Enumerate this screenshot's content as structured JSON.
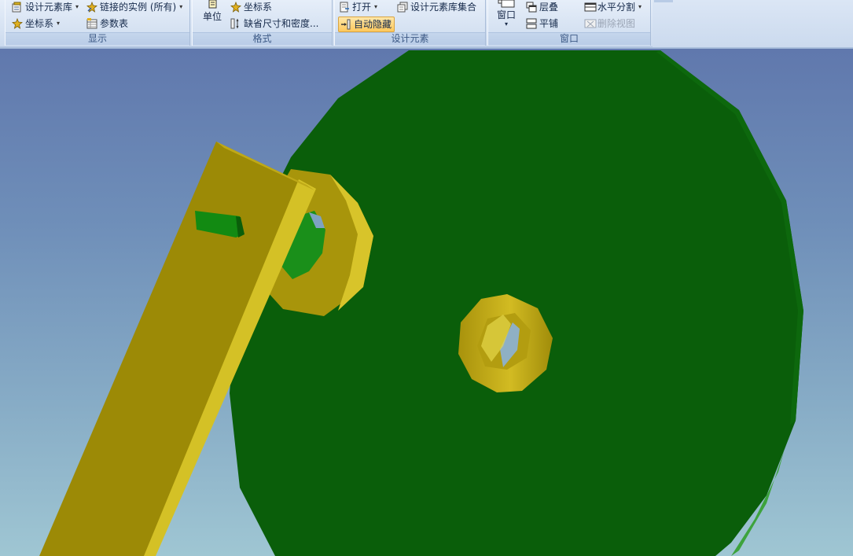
{
  "ribbon": {
    "display": {
      "label": "显示",
      "design_library": "设计元素库",
      "linked_instances": "链接的实例 (所有)",
      "coordinate_system": "坐标系",
      "parameter_table": "参数表"
    },
    "format": {
      "label": "格式",
      "units": "单位",
      "coordinate_system": "坐标系",
      "default_size_density": "缺省尺寸和密度..."
    },
    "design_elements": {
      "label": "设计元素",
      "open": "打开",
      "library_collection": "设计元素库集合",
      "auto_hide": "自动隐藏"
    },
    "window": {
      "label": "窗口",
      "window": "窗口",
      "cascade": "层叠",
      "tile": "平铺",
      "split_horizontal": "水平分割",
      "delete_view": "删除视图"
    }
  },
  "colors": {
    "gear_green": "#0a5e0a",
    "part_gold": "#a9960b",
    "background_top": "#6078ad",
    "background_bottom": "#9fc6d3"
  }
}
